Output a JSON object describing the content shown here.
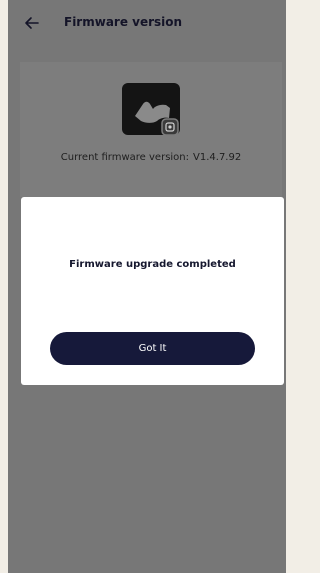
{
  "header": {
    "title": "Firmware version",
    "back_icon": "arrow-left-icon"
  },
  "device": {
    "icon": "camera-app-icon",
    "firmware_label": "Current firmware version:",
    "firmware_value": "V1.4.7.92"
  },
  "dialog": {
    "message": "Firmware upgrade completed",
    "button_label": "Got It"
  },
  "colors": {
    "overlay": "#777777",
    "dialog_bg": "#ffffff",
    "button_bg": "#16193a",
    "button_text": "#ffffff",
    "title_text": "#141428"
  }
}
